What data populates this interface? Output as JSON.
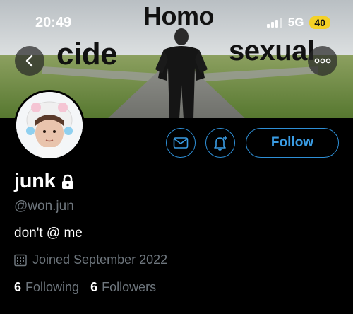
{
  "status_bar": {
    "time": "20:49",
    "network": "5G",
    "battery": "40"
  },
  "banner": {
    "word_top": "Homo",
    "word_left": "cide",
    "word_right": "sexual"
  },
  "profile": {
    "display_name": "junk",
    "handle": "@won.jun",
    "bio": "don't @ me",
    "joined": "Joined September 2022",
    "following_count": "6",
    "following_label": "Following",
    "followers_count": "6",
    "followers_label": "Followers"
  },
  "actions": {
    "follow_label": "Follow"
  },
  "colors": {
    "accent": "#2e8fd6",
    "secondary_text": "#6e767d",
    "background": "#000000",
    "battery": "#f4d126"
  },
  "icons": [
    "back-arrow-icon",
    "more-icon",
    "mail-icon",
    "notification-bell-icon",
    "lock-icon",
    "calendar-icon"
  ]
}
